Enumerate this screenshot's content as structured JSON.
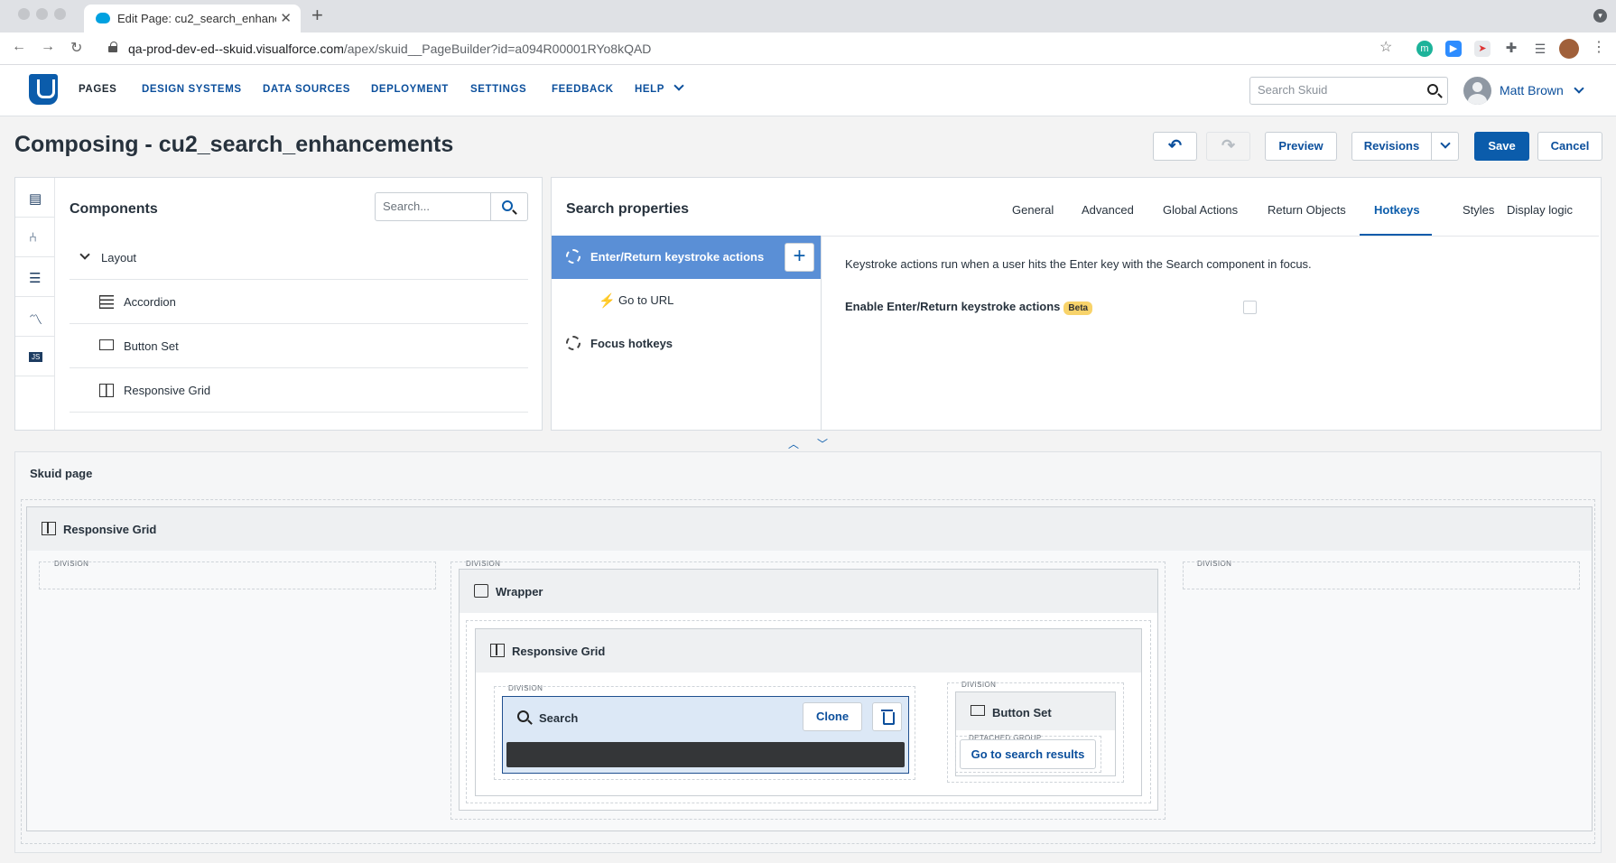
{
  "browser": {
    "tab_title": "Edit Page: cu2_search_enhanc",
    "url_host": "qa-prod-dev-ed--skuid.visualforce.com",
    "url_path": "/apex/skuid__PageBuilder?id=a094R00001RYo8kQAD"
  },
  "header": {
    "nav": [
      "PAGES",
      "DESIGN SYSTEMS",
      "DATA SOURCES",
      "DEPLOYMENT",
      "SETTINGS",
      "FEEDBACK",
      "HELP"
    ],
    "search_placeholder": "Search Skuid",
    "user_name": "Matt Brown"
  },
  "page": {
    "title": "Composing - cu2_search_enhancements",
    "buttons": {
      "preview": "Preview",
      "revisions": "Revisions",
      "save": "Save",
      "cancel": "Cancel"
    }
  },
  "components_panel": {
    "title": "Components",
    "search_placeholder": "Search...",
    "group": "Layout",
    "items": [
      "Accordion",
      "Button Set",
      "Responsive Grid"
    ]
  },
  "properties_panel": {
    "title": "Search properties",
    "tabs": [
      "General",
      "Advanced",
      "Global Actions",
      "Return Objects",
      "Hotkeys",
      "Styles",
      "Display logic"
    ],
    "active_tab": "Hotkeys",
    "hotkeys": {
      "enter_actions": "Enter/Return keystroke actions",
      "go_to_url": "Go to URL",
      "focus_hotkeys": "Focus hotkeys"
    },
    "description": "Keystroke actions run when a user hits the Enter key with the Search component in focus.",
    "enable_label": "Enable Enter/Return keystroke actions",
    "beta_label": "Beta"
  },
  "canvas": {
    "title": "Skuid page",
    "outer_grid": "Responsive Grid",
    "division_label": "DIVISION",
    "wrapper": "Wrapper",
    "inner_grid": "Responsive Grid",
    "search_component": "Search",
    "clone_label": "Clone",
    "button_set": "Button Set",
    "detached_group": "DETACHED GROUP",
    "go_button": "Go to search results"
  }
}
